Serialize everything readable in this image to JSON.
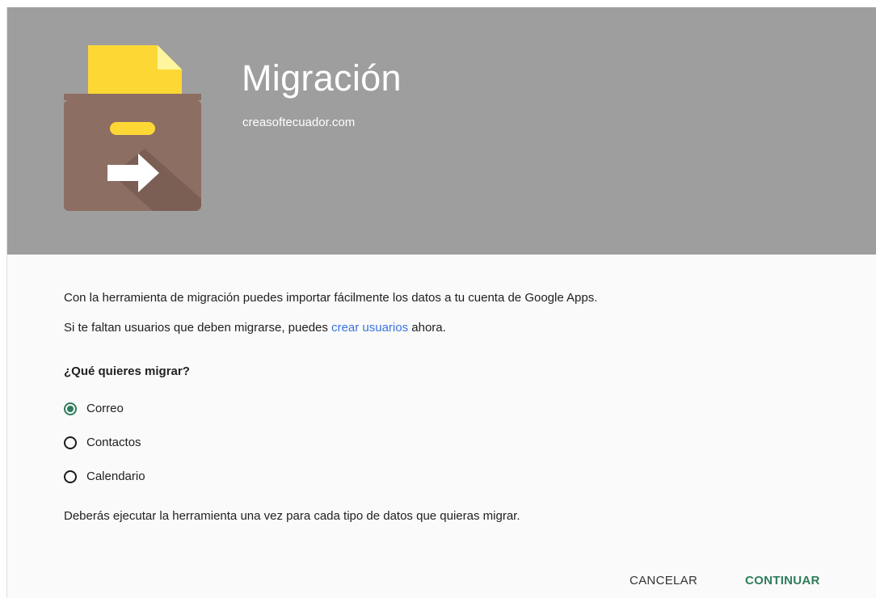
{
  "header": {
    "title": "Migración",
    "domain": "creasoftecuador.com",
    "icon": "migration-box-icon",
    "background_color": "#9e9e9e"
  },
  "content": {
    "intro_line1": "Con la herramienta de migración puedes importar fácilmente los datos a tu cuenta de Google Apps.",
    "intro_line2_before": "Si te faltan usuarios que deben migrarse, puedes ",
    "intro_line2_link": "crear usuarios",
    "intro_line2_after": " ahora.",
    "question": "¿Qué quieres migrar?",
    "options": [
      {
        "label": "Correo",
        "selected": true
      },
      {
        "label": "Contactos",
        "selected": false
      },
      {
        "label": "Calendario",
        "selected": false
      }
    ],
    "note": "Deberás ejecutar la herramienta una vez para cada tipo de datos que quieras migrar."
  },
  "actions": {
    "cancel_label": "CANCELAR",
    "continue_label": "CONTINUAR",
    "accent_color": "#2e7d5b",
    "link_color": "#3b73e0"
  }
}
